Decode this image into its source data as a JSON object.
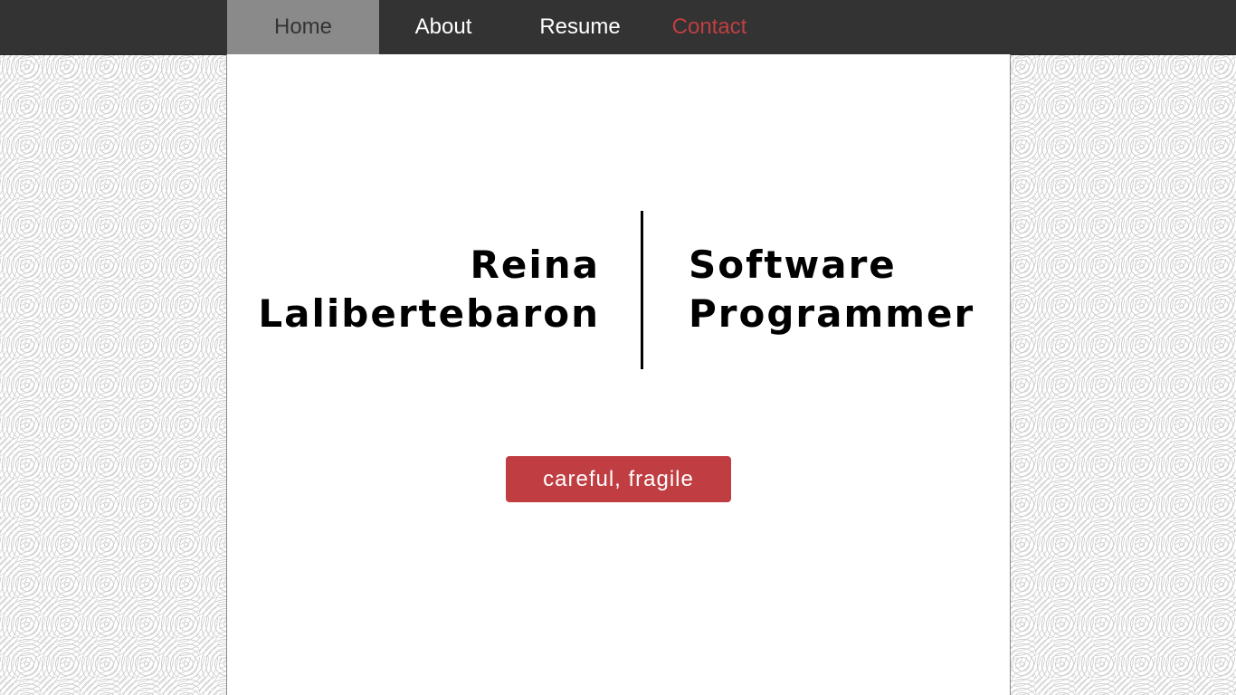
{
  "nav": {
    "items": [
      {
        "label": "Home",
        "active": true
      },
      {
        "label": "About",
        "active": false
      },
      {
        "label": "Resume",
        "active": false
      },
      {
        "label": "Contact",
        "active": false,
        "color": "#c03e42"
      }
    ]
  },
  "hero": {
    "first_name": "Reina",
    "last_name": "Lalibertebaron",
    "title_line1": "Software",
    "title_line2": "Programmer"
  },
  "cta": {
    "label": "careful, fragile",
    "color": "#c03e42"
  },
  "colors": {
    "topbar": "#333333",
    "active_tab": "#8a8a8a",
    "panel": "#ffffff"
  }
}
